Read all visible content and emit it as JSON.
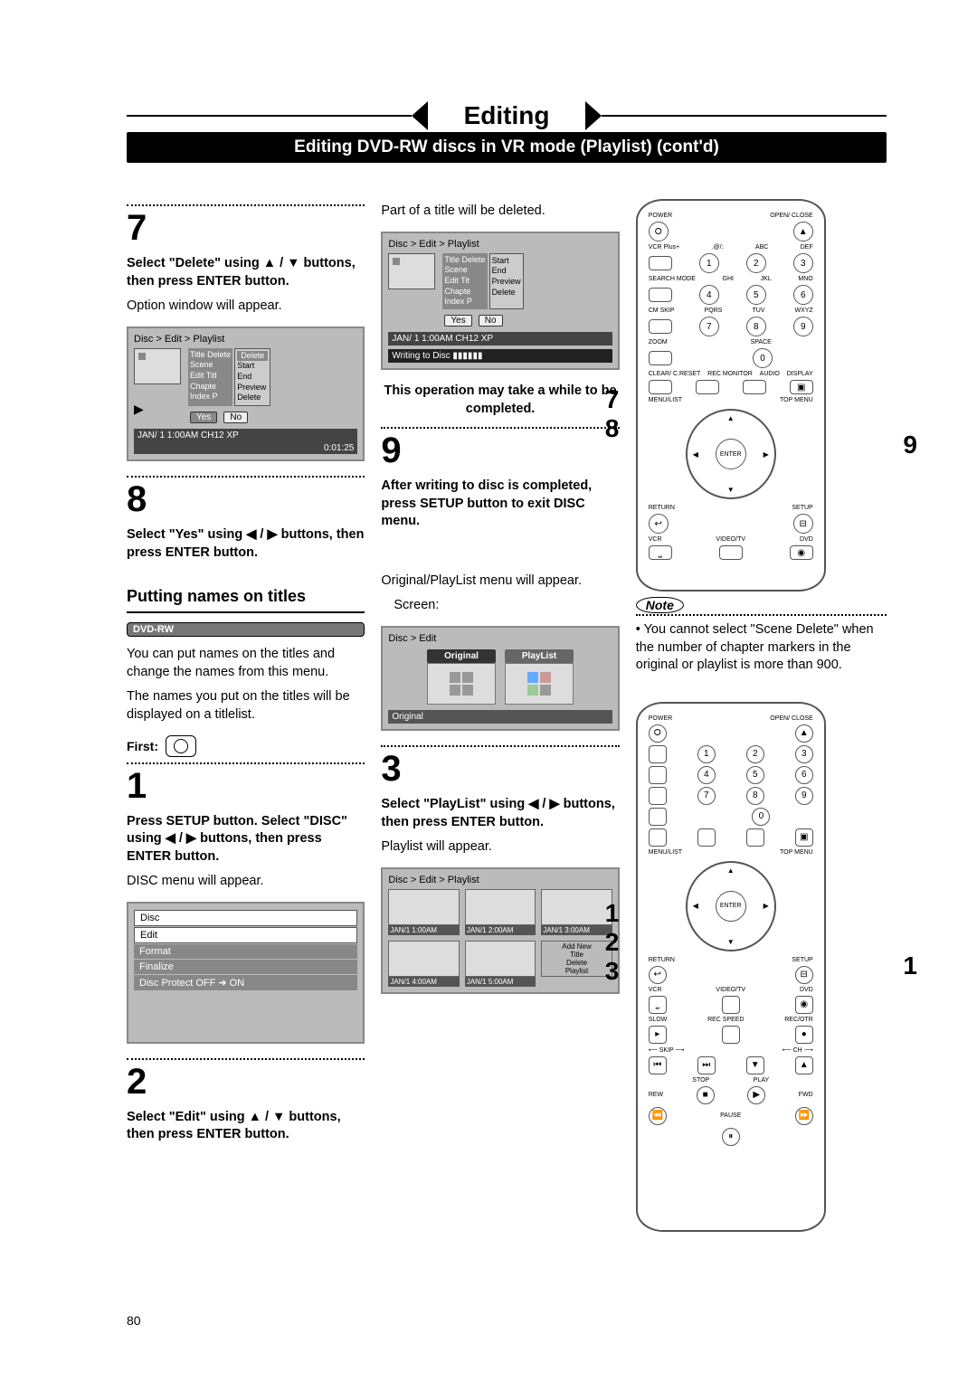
{
  "page_title": "Editing",
  "subtitle": "Editing DVD-RW discs in VR mode (Playlist) (cont'd)",
  "page_number": "80",
  "col1": {
    "step7_num": "7",
    "step7_instr": "Select \"Delete\" using ▲ / ▼ buttons, then press ENTER button.",
    "step7_desc": "Option window will appear.",
    "osd1": {
      "breadcrumb": "Disc > Edit > Playlist",
      "menu": [
        "Title Delete",
        "Scene",
        "Edit Titl",
        "Chapte",
        "Index P"
      ],
      "submenu": [
        "Delete",
        "Start",
        "End",
        "Preview",
        "Delete"
      ],
      "yes": "Yes",
      "no": "No",
      "status": "JAN/ 1   1:00AM  CH12     XP",
      "time": "0:01:25"
    },
    "step8_num": "8",
    "step8_instr": "Select \"Yes\" using ◀ / ▶ buttons, then press ENTER button.",
    "section_heading": "Putting names on titles",
    "badge": "DVD-RW",
    "names_p1": "You can put names on the titles and change the names from this menu.",
    "names_p2": "The names you put on the titles will be displayed on a titlelist.",
    "first_label": "First:",
    "step1_num": "1",
    "step1_instr": "Press SETUP button. Select \"DISC\" using ◀ / ▶ buttons, then press ENTER button.",
    "step1_desc": "DISC menu will appear.",
    "disc_menu": {
      "title": "Disc",
      "items": [
        "Edit",
        "Format",
        "Finalize",
        "Disc Protect OFF ➜ ON"
      ]
    },
    "step2_num": "2",
    "step2_instr": "Select \"Edit\" using ▲ / ▼ buttons, then press ENTER button."
  },
  "col2": {
    "top_line": "Part of a title will be deleted.",
    "osd2": {
      "breadcrumb": "Disc > Edit > Playlist",
      "menu_title": "Title Delete",
      "submenu": [
        "Start",
        "End",
        "Preview",
        "Delete"
      ],
      "yes": "Yes",
      "no": "No",
      "status": "JAN/ 1   1:00AM  CH12     XP",
      "writing": "Writing to Disc ▮▮▮▮▮▮"
    },
    "warn": "This operation may take a while to be completed.",
    "step9_num": "9",
    "step9_instr": "After writing to disc is completed, press SETUP button to exit DISC menu.",
    "origpl_line": "Original/PlayList menu will appear.",
    "screen_label": "Screen:",
    "origpl": {
      "breadcrumb": "Disc > Edit",
      "orig": "Original",
      "pl": "PlayList",
      "foot": "Original"
    },
    "step3_num": "3",
    "step3_instr": "Select \"PlayList\" using ◀ / ▶ buttons, then press ENTER button.",
    "step3_desc": "Playlist will appear.",
    "plgrid": {
      "breadcrumb": "Disc > Edit > Playlist",
      "caps": [
        "JAN/1  1:00AM",
        "JAN/1  2:00AM",
        "JAN/1  3:00AM",
        "JAN/1  4:00AM",
        "JAN/1  5:00AM"
      ],
      "addnew": [
        "Add New",
        "Title",
        "Delete",
        "Playlist"
      ]
    }
  },
  "col3": {
    "remote1_left": [
      "7",
      "8"
    ],
    "remote1_right": "9",
    "note_head": "Note",
    "note_body": "You cannot select \"Scene Delete\" when the number of chapter markers in the original or playlist is more than 900.",
    "remote2_left": [
      "1",
      "2",
      "3"
    ],
    "remote2_right": "1",
    "enter": "ENTER",
    "labels": {
      "power": "POWER",
      "open": "OPEN/\nCLOSE",
      "vcrplus": "VCR Plus+",
      "abc": "ABC",
      "def": "DEF",
      "search": "SEARCH\nMODE",
      "ghi": "GHI",
      "jkl": "JKL",
      "mno": "MNO",
      "pqrs": "PQRS",
      "tuv": "TUV",
      "wxyz": "WXYZ",
      "cmskip": "CM SKIP",
      "space": "SPACE",
      "zoom": "ZOOM",
      "clear": "CLEAR/\nC.RESET",
      "rec": "REC\nMONITOR",
      "audio": "AUDIO",
      "display": "DISPLAY",
      "menulist": "MENU/LIST",
      "topmenu": "TOP MENU",
      "return": "RETURN",
      "setup": "SETUP",
      "vcr": "VCR",
      "videotv": "VIDEO/TV",
      "dvd": "DVD",
      "slow": "SLOW",
      "recspeed": "REC\nSPEED",
      "recotr": "REC/OTR",
      "skip": "SKIP",
      "ch": "CH",
      "stop": "STOP",
      "play": "PLAY",
      "rew": "REW",
      "fwd": "FWD",
      "pause": "PAUSE"
    }
  }
}
